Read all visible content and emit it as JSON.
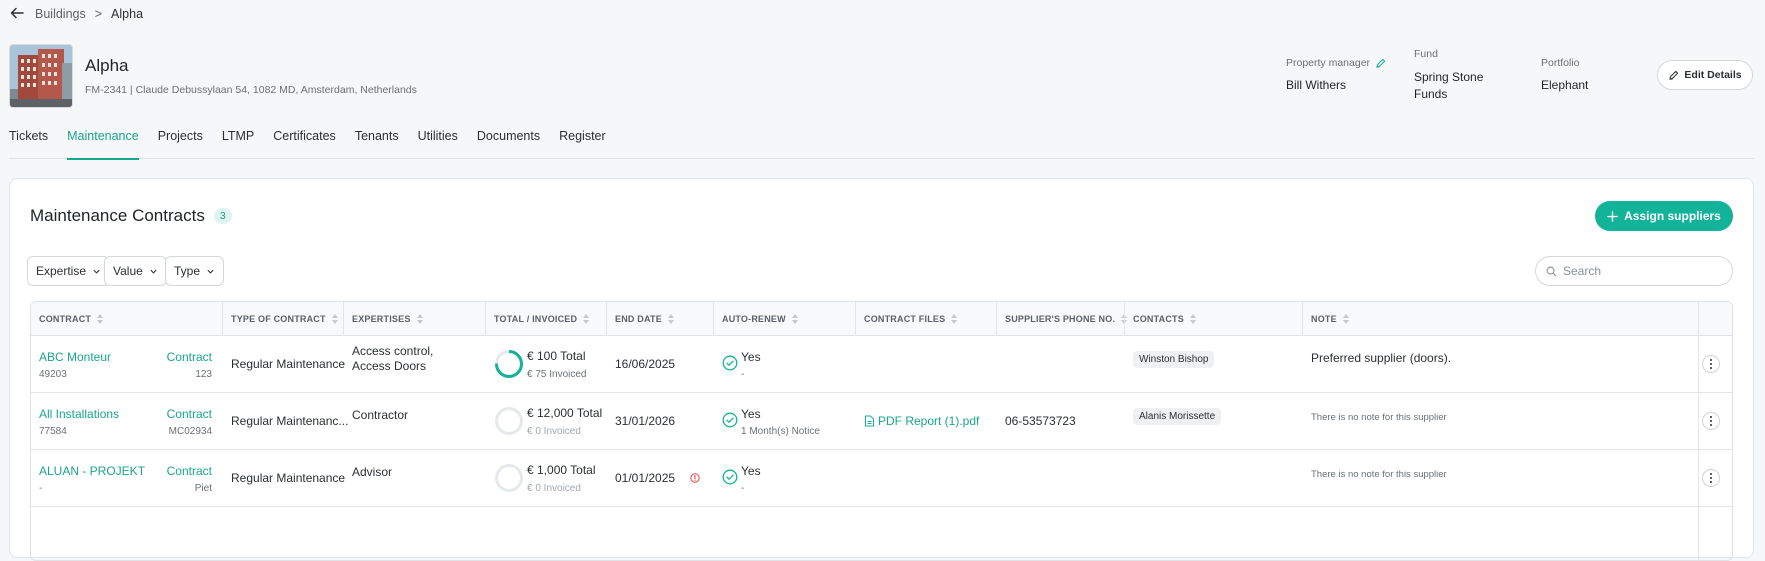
{
  "breadcrumb": {
    "parent": "Buildings",
    "separator": ">",
    "current": "Alpha"
  },
  "building": {
    "name": "Alpha",
    "address": "FM-2341 | Claude Debussylaan 54, 1082 MD, Amsterdam, Netherlands",
    "property_manager_label": "Property manager",
    "property_manager": "Bill Withers",
    "fund_label": "Fund",
    "fund_line1": "Spring Stone",
    "fund_line2": "Funds",
    "portfolio_label": "Portfolio",
    "portfolio": "Elephant",
    "edit_label": "Edit Details"
  },
  "tabs": [
    {
      "label": "Tickets"
    },
    {
      "label": "Maintenance"
    },
    {
      "label": "Projects"
    },
    {
      "label": "LTMP"
    },
    {
      "label": "Certificates"
    },
    {
      "label": "Tenants"
    },
    {
      "label": "Utilities"
    },
    {
      "label": "Documents"
    },
    {
      "label": "Register"
    }
  ],
  "active_tab": "Maintenance",
  "section": {
    "title": "Maintenance Contracts",
    "count": "3",
    "assign_label": "Assign suppliers",
    "filters": [
      "Expertise",
      "Value",
      "Type"
    ],
    "search_placeholder": "Search"
  },
  "columns": [
    "CONTRACT",
    "TYPE OF CONTRACT",
    "EXPERTISES",
    "TOTAL / INVOICED",
    "END DATE",
    "AUTO-RENEW",
    "CONTRACT FILES",
    "SUPPLIER'S PHONE NO.",
    "CONTACTS",
    "NOTE"
  ],
  "rows": [
    {
      "supplier": "ABC Monteur",
      "supplier_id": "49203",
      "contract_link": "Contract",
      "contract_no": "123",
      "type": "Regular Maintenance",
      "expertise_line1": "Access control,",
      "expertise_line2": "Access Doors",
      "total": "€ 100 Total",
      "invoiced": "€ 75 Invoiced",
      "invoiced_ratio": 0.75,
      "end_date": "16/06/2025",
      "auto_renew": "Yes",
      "notice": "-",
      "file": "",
      "phone": "",
      "contact": "Winston Bishop",
      "note": "Preferred supplier (doors)."
    },
    {
      "supplier": "All Installations",
      "supplier_id": "77584",
      "contract_link": "Contract",
      "contract_no": "MC02934",
      "type": "Regular Maintenanc...",
      "expertise_line1": "Contractor",
      "expertise_line2": "",
      "total": "€ 12,000 Total",
      "invoiced": "€ 0 Invoiced",
      "invoiced_ratio": 0,
      "end_date": "31/01/2026",
      "auto_renew": "Yes",
      "notice": "1 Month(s) Notice",
      "file": "PDF Report (1).pdf",
      "phone": "06-53573723",
      "contact": "Alanis Morissette",
      "note": "There is no note for this supplier"
    },
    {
      "supplier": "ALUAN - PROJEKT",
      "supplier_id": "-",
      "contract_link": "Contract",
      "contract_no": "Piet",
      "type": "Regular Maintenance",
      "expertise_line1": "Advisor",
      "expertise_line2": "",
      "total": "€ 1,000 Total",
      "invoiced": "€ 0 Invoiced",
      "invoiced_ratio": 0,
      "end_date": "01/01/2025",
      "auto_renew": "Yes",
      "notice": "-",
      "file": "",
      "phone": "",
      "contact": "",
      "note": "There is no note for this supplier"
    }
  ],
  "colors": {
    "accent": "#13b39a",
    "warning": "#e5484d"
  }
}
